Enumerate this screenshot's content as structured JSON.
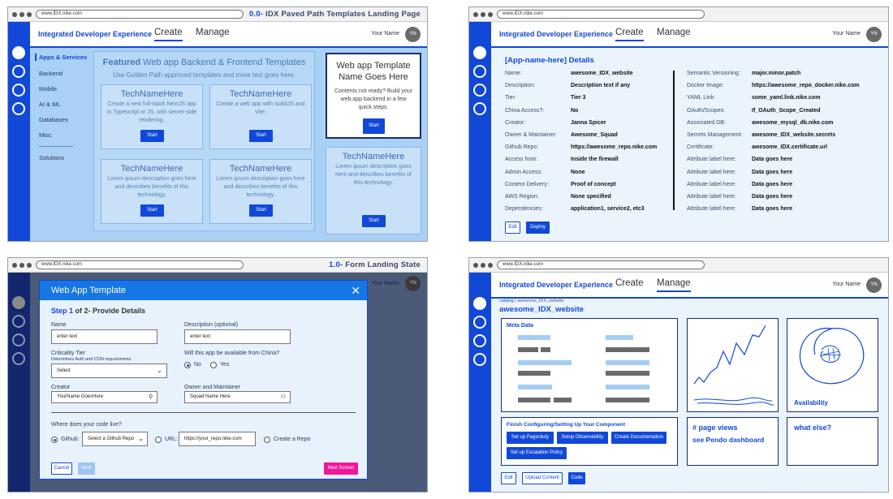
{
  "browser": {
    "url": "www.IDX.nike.com",
    "dots": [
      "window-dot",
      "window-dot",
      "window-dot"
    ]
  },
  "app": {
    "brand": "Integrated Developer Experience",
    "nav_create": "Create",
    "nav_manage": "Manage",
    "user_name": "Your Name",
    "avatar": "YN"
  },
  "p1": {
    "title_prefix": "0.0-",
    "title": "IDX Paved Path Templates Landing Page",
    "sidebar": [
      "Apps & Services",
      "Backend",
      "Mobile",
      "AI & ML",
      "Databases",
      "Misc",
      "Solutions"
    ],
    "featured_bold": "Featured",
    "featured_rest": "Web app Backend & Frontend Templates",
    "subtitle": "Use Golden Path approved templates and more text goes here.",
    "cards": [
      {
        "title": "TechNameHere",
        "desc": "Create a new full-stack NextJS app in Typescript or JS, with server-side rendering.",
        "btn": "Start"
      },
      {
        "title": "TechNameHere",
        "desc": "Create a web app with SolidJS and Vite.",
        "btn": "Start"
      },
      {
        "title": "TechNameHere",
        "desc": "Lorem ipsum description goes here and describes benefits of this technology.",
        "btn": "Start"
      },
      {
        "title": "TechNameHere",
        "desc": "Lorem ipsum description goes here and describes benefits of this technology.",
        "btn": "Start"
      }
    ],
    "template_title": "Web app Template Name Goes Here",
    "template_desc": "Contents not ready? Build your web app backend in a few quick steps.",
    "template_btn": "Start",
    "side_card": {
      "title": "TechNameHere",
      "desc": "Lorem ipsum description goes here and describes benefits of this technology.",
      "btn": "Start"
    }
  },
  "p2": {
    "heading": "[App-name-here] Details",
    "left": [
      [
        "Name:",
        "awesome_IDX_website"
      ],
      [
        "Description:",
        "Description text if any"
      ],
      [
        "Tier:",
        "Tier 3"
      ],
      [
        "China Access?:",
        "No"
      ],
      [
        "Creator:",
        "Janna Spicer"
      ],
      [
        "Owner & Maintainer:",
        "Awesome_Squad"
      ],
      [
        "Github Repo:",
        "https://awesome_repo.nike.com"
      ],
      [
        "Access from:",
        "Inside the firewall"
      ],
      [
        "Admin Access:",
        "None"
      ],
      [
        "Content Delivery:",
        "Proof of concept"
      ],
      [
        "AWS Region:",
        "None specified"
      ],
      [
        "Dependencies:",
        "application1, service2, etc3"
      ]
    ],
    "right": [
      [
        "Semantic Versioning:",
        "major.minor.patch"
      ],
      [
        "Docker Image:",
        "https://awesome_repo_docker.nike.com"
      ],
      [
        "YAML Link:",
        "some_yaml.link.nike.com"
      ],
      [
        "OAuth/Scopes:",
        "If_OAuth_Scope_Created"
      ],
      [
        "Associated DB:",
        "awesome_mysql_db.nike.com"
      ],
      [
        "Secrets Management:",
        "awesome_IDX_website.secrets"
      ],
      [
        "Certificate:",
        "awesome_IDX.certificate.url"
      ],
      [
        "Attribute label here:",
        "Data goes here"
      ],
      [
        "Attribute label here:",
        "Data goes here"
      ],
      [
        "Attribute label here:",
        "Data goes here"
      ],
      [
        "Attribute label here:",
        "Data goes here"
      ],
      [
        "Attribute label here:",
        "Data goes here"
      ]
    ],
    "edit_btn": "Edit",
    "deploy_btn": "Deploy"
  },
  "p3": {
    "title_prefix": "1.0-",
    "title": "Form Landing State",
    "modal_title": "Web App Template",
    "step_bold": "Step 1",
    "step_rest": "of 2- Provide Details",
    "name_label": "Name",
    "name_value": "enter text",
    "desc_label": "Description (optional)",
    "desc_value": "enter text",
    "tier_label": "Criticality Tier",
    "tier_hint": "Determines Auth and CDN requirements",
    "tier_value": "Select",
    "china_label": "Will this app be available from China?",
    "china_no": "No",
    "china_yes": "Yes",
    "creator_label": "Creator",
    "creator_value": "YourName GoesHere",
    "owner_label": "Owner and Maintainer",
    "owner_value": "Squad Name Here",
    "code_label": "Where does your code live?",
    "github_label": "Github:",
    "github_select": "Select a Github Repo",
    "url_label": "URL:",
    "url_value": "https://your_repo.nike.com",
    "create_repo": "Create a Repo",
    "cancel_btn": "Cancel",
    "next_btn": "Next",
    "next_screen_btn": "Next Screen"
  },
  "p4": {
    "crumb_link": "catalog",
    "crumb_current": "awesome_IDX_website",
    "app_title": "awesome_IDX_website",
    "meta_title": "Meta Data",
    "availability": "Availability",
    "config_title": "Finish Configuring/Setting Up Your Component",
    "config_btns": [
      "Set up Pagerduty",
      "Setup Observability",
      "Create Documentation",
      "Set up Escalation Policy"
    ],
    "page_views": "# page views",
    "pendo": "see Pendo dashboard",
    "what_else": "what else?",
    "edit_btn": "Edit",
    "upload_btn": "Upload Content",
    "code_btn": "Code"
  }
}
